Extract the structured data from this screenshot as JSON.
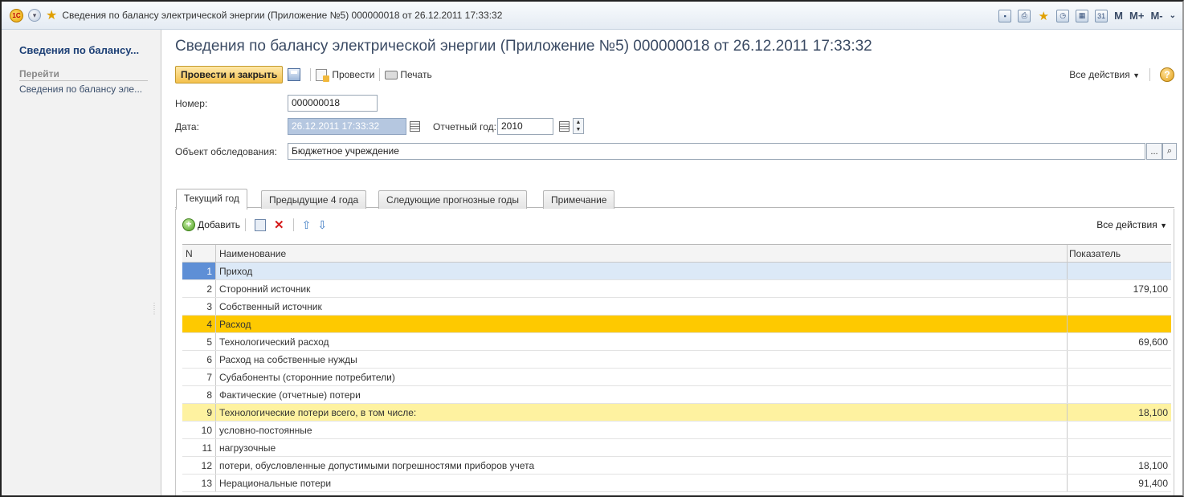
{
  "window": {
    "title": "Сведения по балансу электрической энергии (Приложение №5) 000000018 от 26.12.2011 17:33:32",
    "logo_text": "1С",
    "tb_icons": [
      "save-icon",
      "print-icon",
      "favorite-icon",
      "history-icon",
      "calculator-icon",
      "calendar-icon"
    ],
    "memory_buttons": [
      "M",
      "M+",
      "M-"
    ]
  },
  "sidebar": {
    "title": "Сведения по балансу...",
    "section": "Перейти",
    "link": "Сведения по балансу эле..."
  },
  "form": {
    "title": "Сведения по балансу электрической энергии (Приложение №5) 000000018 от 26.12.2011 17:33:32",
    "toolbar": {
      "post_close": "Провести и закрыть",
      "post": "Провести",
      "print": "Печать",
      "all_actions": "Все действия",
      "help": "?"
    },
    "number_label": "Номер:",
    "number_value": "000000018",
    "date_label": "Дата:",
    "date_value": "26.12.2011 17:33:32",
    "year_label": "Отчетный год:",
    "year_value": "2010",
    "object_label": "Объект обследования:",
    "object_value": "Бюджетное учреждение",
    "object_btn": "..."
  },
  "tabs": [
    "Текущий год",
    "Предыдущие 4 года",
    "Следующие прогнозные годы",
    "Примечание"
  ],
  "grid": {
    "add_label": "Добавить",
    "all_actions": "Все действия",
    "columns": {
      "n": "N",
      "name": "Наименование",
      "value": "Показатель"
    },
    "rows": [
      {
        "n": "1",
        "name": "Приход",
        "value": "",
        "style": "sel"
      },
      {
        "n": "2",
        "name": "Сторонний источник",
        "value": "179,100",
        "style": ""
      },
      {
        "n": "3",
        "name": "Собственный источник",
        "value": "",
        "style": ""
      },
      {
        "n": "4",
        "name": "Расход",
        "value": "",
        "style": "orange"
      },
      {
        "n": "5",
        "name": "Технологический расход",
        "value": "69,600",
        "style": ""
      },
      {
        "n": "6",
        "name": "Расход на собственные нужды",
        "value": "",
        "style": ""
      },
      {
        "n": "7",
        "name": "Субабоненты (сторонние потребители)",
        "value": "",
        "style": ""
      },
      {
        "n": "8",
        "name": "Фактические (отчетные) потери",
        "value": "",
        "style": ""
      },
      {
        "n": "9",
        "name": "Технологические потери всего, в том числе:",
        "value": "18,100",
        "style": "yellow"
      },
      {
        "n": "10",
        "name": "условно-постоянные",
        "value": "",
        "style": ""
      },
      {
        "n": "11",
        "name": "нагрузочные",
        "value": "",
        "style": ""
      },
      {
        "n": "12",
        "name": "потери, обусловленные допустимыми погрешностями приборов учета",
        "value": "18,100",
        "style": ""
      },
      {
        "n": "13",
        "name": "Нерациональные потери",
        "value": "91,400",
        "style": ""
      }
    ]
  }
}
